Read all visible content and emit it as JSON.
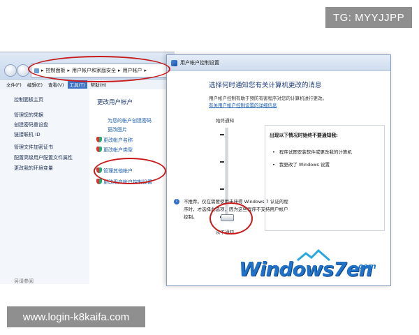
{
  "watermarks": {
    "top": "TG: MYYJJPP",
    "bottom": "www.login-k8kaifa.com"
  },
  "explorer": {
    "address_items": [
      "控制面板",
      "用户帐户和家庭安全",
      "用户帐户"
    ],
    "menu": [
      "文件(F)",
      "编辑(E)",
      "查看(V)",
      "工具(T)",
      "帮助(H)"
    ],
    "menu_selected_index": 3,
    "left_links": [
      "控制面板主页",
      "管理您的凭据",
      "创建密码重设盘",
      "链接联机 ID",
      "管理文件加密证书",
      "配置高级用户配置文件属性",
      "更改我的环境变量"
    ],
    "left_bottom": "另请参阅",
    "right_heading": "更改用户帐户",
    "right_links": [
      "为您的帐户创建密码",
      "更改图片",
      "更改帐户名称",
      "更改帐户类型",
      "管理其他帐户",
      "更改用户帐户控制设置"
    ]
  },
  "uac": {
    "title": "用户帐户控制设置",
    "heading": "选择何时通知您有关计算机更改的消息",
    "description": "用户帐户控制有助于预防有害程序对您的计算机进行更改。",
    "help_link": "有关用户帐户控制设置的详细信息",
    "slider_top": "始终通知",
    "slider_bottom": "从不通知",
    "slider_level": 0,
    "info_heading": "出现以下情况时始终不要通知我:",
    "info_bullets": [
      "程序试图安装软件或更改我的计算机",
      "我更改了 Windows 设置"
    ],
    "note_lines": [
      "不推荐。仅在需要使用未获得 Windows 7 认证的程",
      "序时，才选择此选项，因为这些程序不支持用户帐户",
      "控制。"
    ],
    "logo_text": "Windows7en",
    "logo_suffix": ".com"
  }
}
